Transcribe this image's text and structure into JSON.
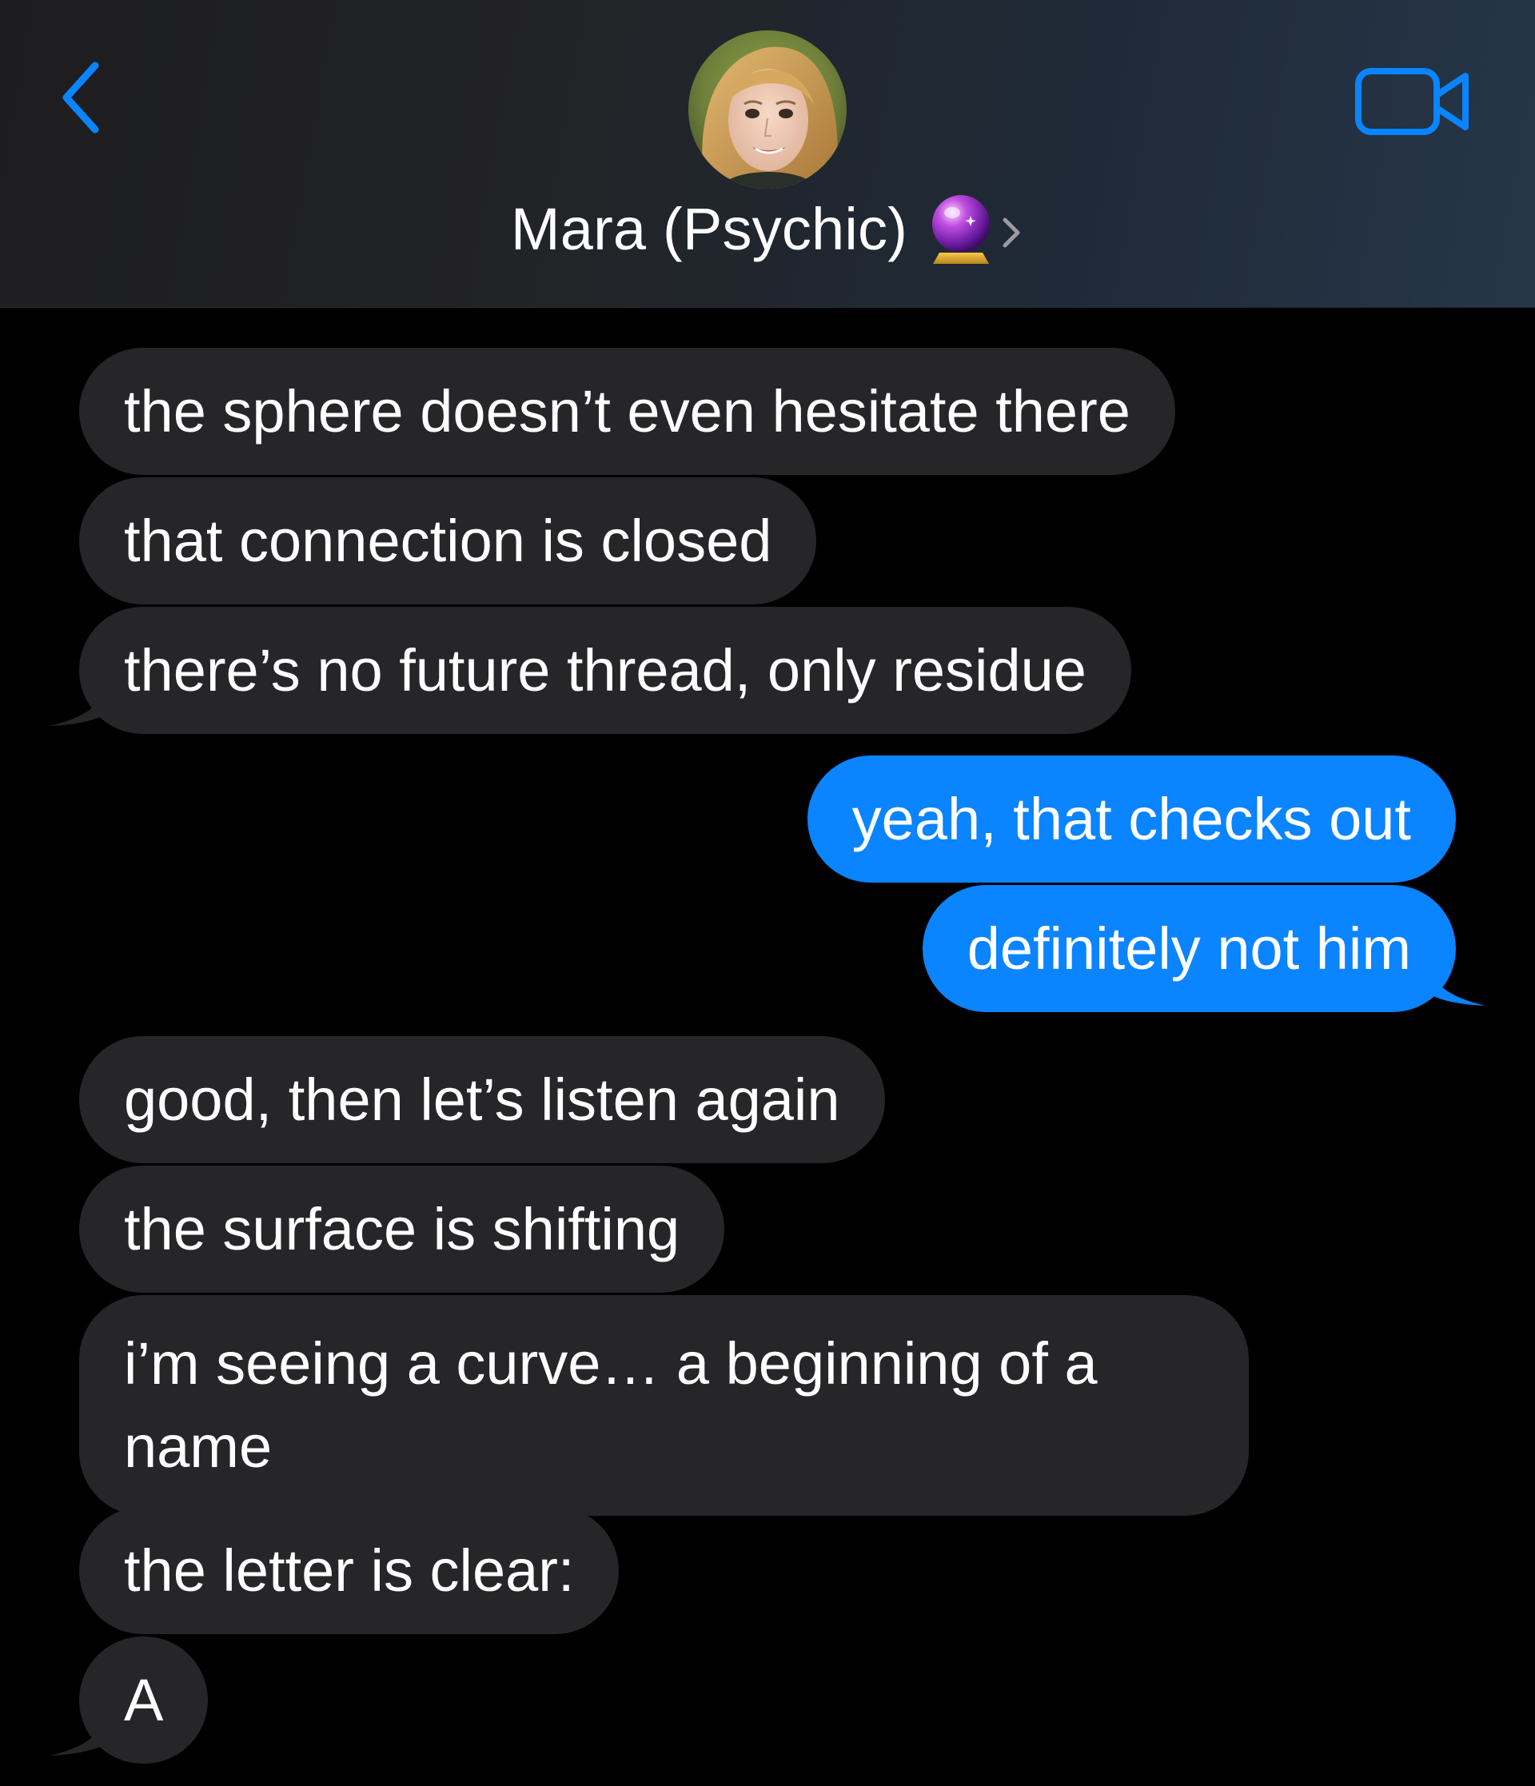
{
  "header": {
    "contact_name": "Mara (Psychic)",
    "contact_emoji": "crystal-ball",
    "back_icon": "chevron-left-icon",
    "video_icon": "video-camera-icon",
    "accent_color": "#0a84ff"
  },
  "messages": [
    {
      "sender": "contact",
      "text": "the sphere doesn’t even hesitate there"
    },
    {
      "sender": "contact",
      "text": "that connection is closed"
    },
    {
      "sender": "contact",
      "text": "there’s no future thread, only residue"
    },
    {
      "sender": "me",
      "text": "yeah, that checks out"
    },
    {
      "sender": "me",
      "text": "definitely not him"
    },
    {
      "sender": "contact",
      "text": "good, then let’s listen again"
    },
    {
      "sender": "contact",
      "text": "the surface is shifting"
    },
    {
      "sender": "contact",
      "text": "i’m seeing a curve… a beginning of a name"
    },
    {
      "sender": "contact",
      "text": "the letter is clear:"
    },
    {
      "sender": "contact",
      "text": "A"
    }
  ],
  "colors": {
    "incoming_bubble": "#262629",
    "outgoing_bubble": "#0a84ff",
    "background": "#000000"
  }
}
